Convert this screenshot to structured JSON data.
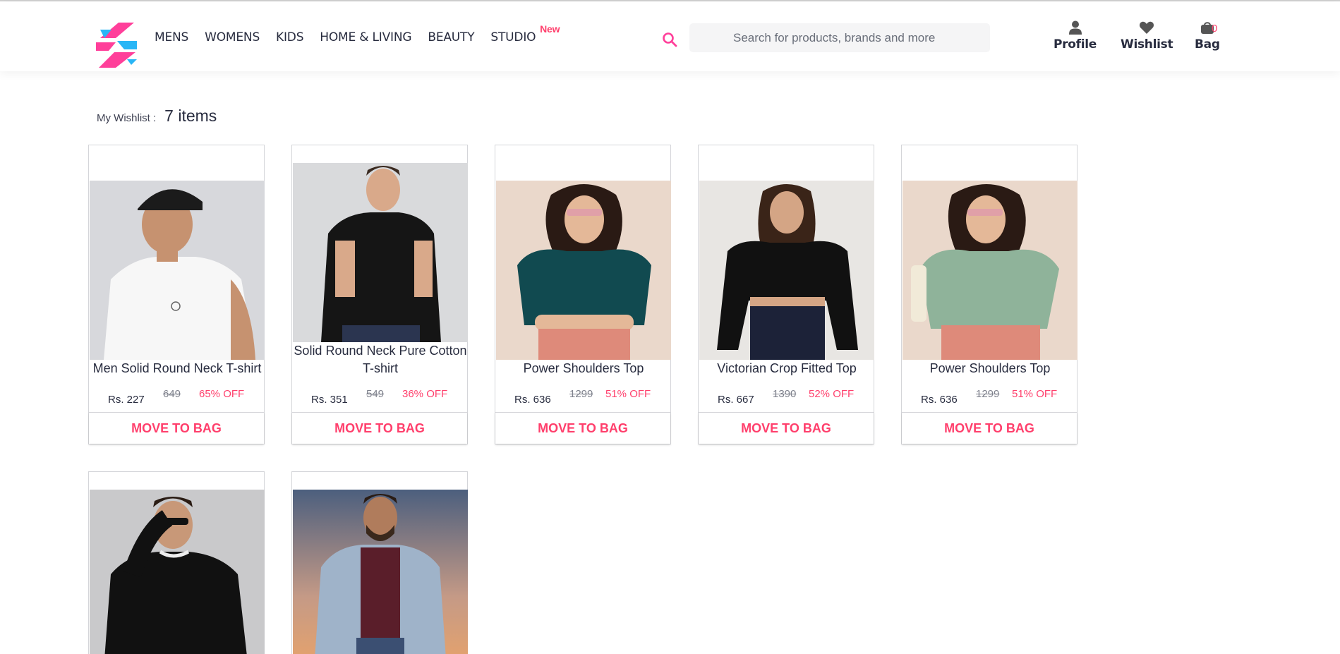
{
  "header": {
    "nav": [
      {
        "label": "MENS"
      },
      {
        "label": "WOMENS"
      },
      {
        "label": "KIDS"
      },
      {
        "label": "HOME & LIVING"
      },
      {
        "label": "BEAUTY"
      },
      {
        "label": "STUDIO",
        "badge": "New"
      }
    ],
    "search": {
      "placeholder": "Search for products, brands and more"
    },
    "actions": {
      "profile": {
        "label": "Profile",
        "icon": "user-icon"
      },
      "wishlist": {
        "label": "Wishlist",
        "icon": "heart-icon"
      },
      "bag": {
        "label": "Bag",
        "icon": "bag-icon",
        "count": "0"
      }
    },
    "accent_color": "#ff3f6c"
  },
  "wishlist": {
    "label": "My Wishlist :",
    "count_text": "7 items",
    "items": [
      {
        "title": "Men Solid Round Neck T-shirt",
        "price": "Rs. 227",
        "mrp": "649",
        "discount": "65% OFF",
        "button": "MOVE TO BAG",
        "image": "man-white-tshirt-cap"
      },
      {
        "title": "Solid Round Neck Pure Cotton T-shirt",
        "price": "Rs. 351",
        "mrp": "549",
        "discount": "36% OFF",
        "button": "MOVE TO BAG",
        "image": "man-black-tshirt"
      },
      {
        "title": "Power Shoulders Top",
        "price": "Rs. 636",
        "mrp": "1299",
        "discount": "51% OFF",
        "button": "MOVE TO BAG",
        "image": "woman-teal-puff-top"
      },
      {
        "title": "Victorian Crop Fitted Top",
        "price": "Rs. 667",
        "mrp": "1390",
        "discount": "52% OFF",
        "button": "MOVE TO BAG",
        "image": "woman-black-crop-top"
      },
      {
        "title": "Power Shoulders Top",
        "price": "Rs. 636",
        "mrp": "1299",
        "discount": "51% OFF",
        "button": "MOVE TO BAG",
        "image": "woman-sage-puff-top"
      },
      {
        "title": "",
        "image": "man-black-sweatshirt-sunglasses"
      },
      {
        "title": "",
        "image": "man-denim-jacket"
      }
    ]
  }
}
